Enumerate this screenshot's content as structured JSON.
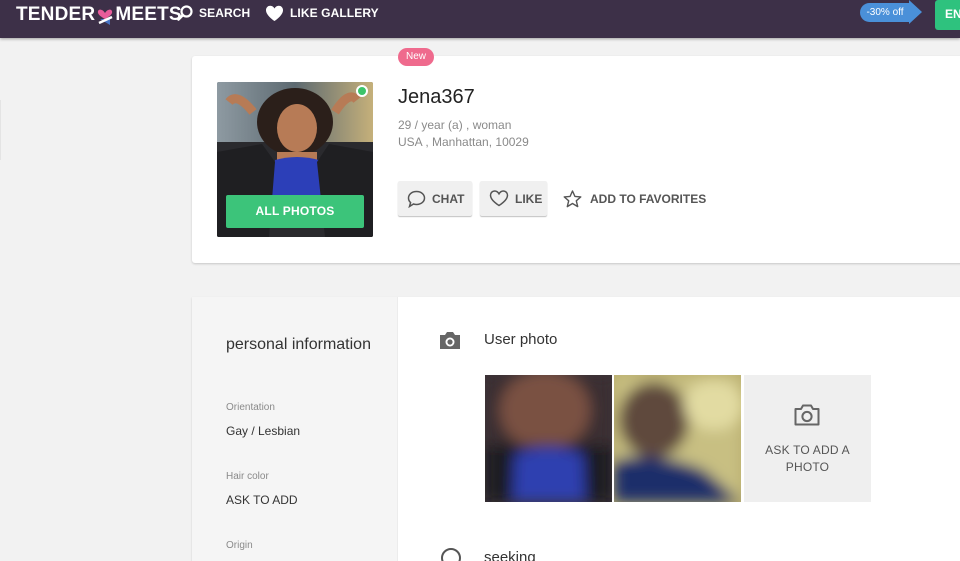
{
  "header": {
    "logo_left": "TENDER",
    "logo_right": "MEETS",
    "nav": [
      {
        "label": "SEARCH",
        "icon": "search-icon"
      },
      {
        "label": "LIKE GALLERY",
        "icon": "heart-icon"
      }
    ],
    "discount": "-30% off",
    "lang_button": "EN",
    "colors": {
      "bar": "#3d3048",
      "discount": "#4a90d9",
      "lang": "#2ec27e",
      "logo_heart": "#e95c9b"
    }
  },
  "profile": {
    "badge": "New",
    "username": "Jena367",
    "age_gender": "29 / year (a) , woman",
    "location": "USA , Manhattan, 10029",
    "all_photos": "ALL PHOTOS",
    "online": true,
    "actions": {
      "chat": "CHAT",
      "like": "LIKE",
      "favorites": "ADD TO FAVORITES"
    },
    "colors": {
      "badge": "#ef6a8d",
      "online": "#3cc46a",
      "all_photos": "#3cc47a"
    }
  },
  "personal": {
    "title": "personal information",
    "fields": [
      {
        "label": "Orientation",
        "value": "Gay / Lesbian"
      },
      {
        "label": "Hair color",
        "value": "ASK TO ADD"
      },
      {
        "label": "Origin",
        "value": ""
      }
    ]
  },
  "photos_section": {
    "title": "User photo",
    "icon": "camera-icon",
    "ask_to_add": "ASK TO ADD A PHOTO"
  },
  "seeking_section": {
    "title": "seeking",
    "icon": "search-icon"
  }
}
